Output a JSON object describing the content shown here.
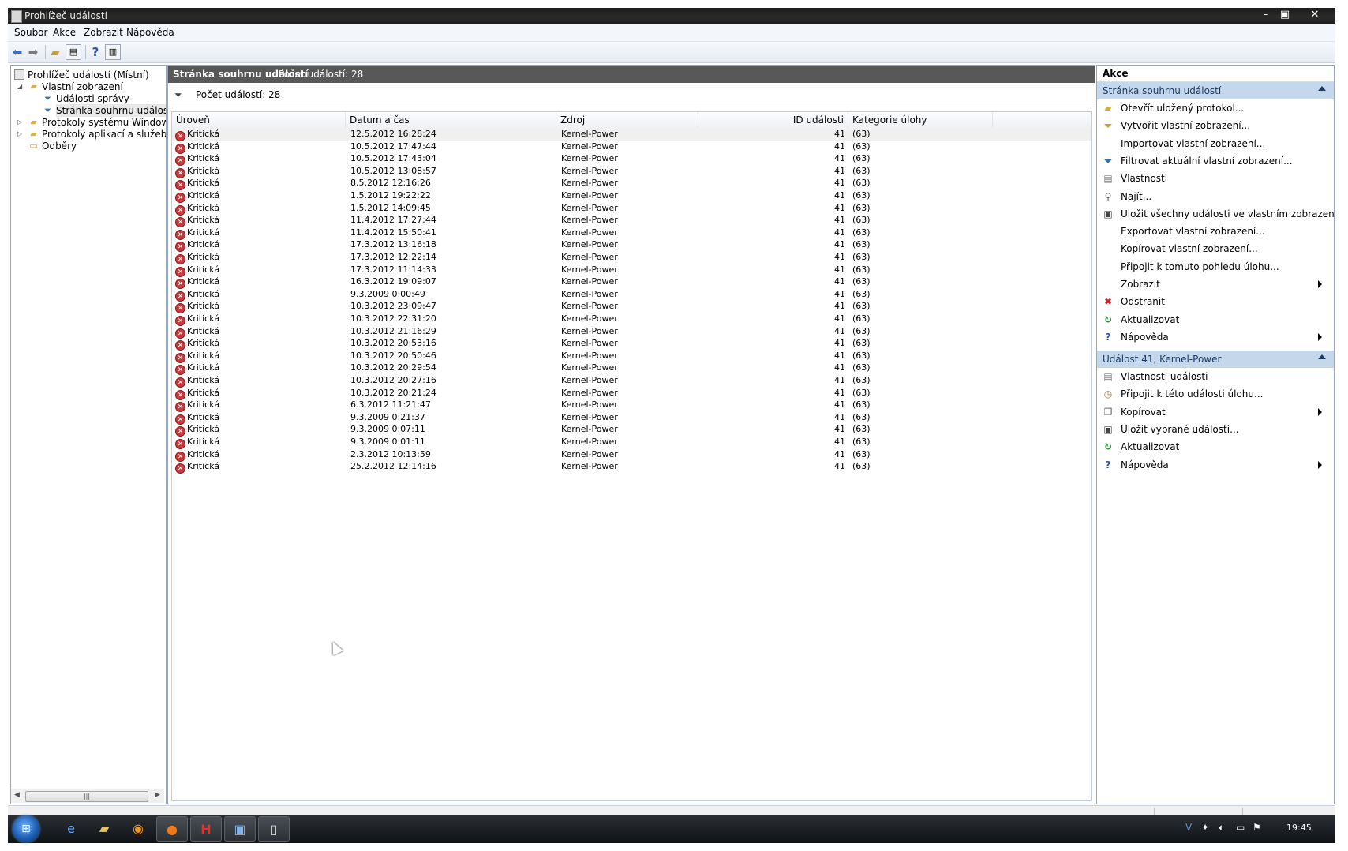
{
  "window": {
    "title": "Prohlížeč událostí",
    "controls": {
      "minimize": "–",
      "maximize": "▣",
      "close": "✕"
    }
  },
  "menu": [
    "Soubor",
    "Akce",
    "Zobrazit",
    "Nápověda"
  ],
  "toolbar": {
    "icons": [
      "back-arrow-icon",
      "forward-arrow-icon",
      "up-folder-icon",
      "show-hide-tree-icon",
      "help-icon",
      "show-hide-action-pane-icon"
    ]
  },
  "tree": [
    {
      "label": "Prohlížeč událostí (Místní)",
      "icon": "event-viewer-icon",
      "level": 0,
      "expander": ""
    },
    {
      "label": "Vlastní zobrazení",
      "icon": "folder-icon",
      "level": 1,
      "expander": "◢"
    },
    {
      "label": "Události správy",
      "icon": "filter-icon",
      "level": 2,
      "expander": ""
    },
    {
      "label": "Stránka souhrnu událostí",
      "icon": "filter-icon",
      "level": 2,
      "expander": "",
      "selected": true
    },
    {
      "label": "Protokoly systému Windows",
      "icon": "folder-icon",
      "level": 1,
      "expander": "▷"
    },
    {
      "label": "Protokoly aplikací a služeb",
      "icon": "folder-icon",
      "level": 1,
      "expander": "▷"
    },
    {
      "label": "Odběry",
      "icon": "subscriptions-icon",
      "level": 1,
      "expander": ""
    }
  ],
  "center": {
    "header_title": "Stránka souhrnu událostí",
    "header_count": "Počet událostí: 28",
    "filter_text": "Počet událostí: 28",
    "columns": [
      "Úroveň",
      "Datum a čas",
      "Zdroj",
      "ID události",
      "Kategorie úlohy"
    ],
    "rows": [
      {
        "level": "Kritická",
        "date": "12.5.2012 16:28:24",
        "source": "Kernel-Power",
        "id": "41",
        "cat": "(63)"
      },
      {
        "level": "Kritická",
        "date": "10.5.2012 17:47:44",
        "source": "Kernel-Power",
        "id": "41",
        "cat": "(63)"
      },
      {
        "level": "Kritická",
        "date": "10.5.2012 17:43:04",
        "source": "Kernel-Power",
        "id": "41",
        "cat": "(63)"
      },
      {
        "level": "Kritická",
        "date": "10.5.2012 13:08:57",
        "source": "Kernel-Power",
        "id": "41",
        "cat": "(63)"
      },
      {
        "level": "Kritická",
        "date": "8.5.2012 12:16:26",
        "source": "Kernel-Power",
        "id": "41",
        "cat": "(63)"
      },
      {
        "level": "Kritická",
        "date": "1.5.2012 19:22:22",
        "source": "Kernel-Power",
        "id": "41",
        "cat": "(63)"
      },
      {
        "level": "Kritická",
        "date": "1.5.2012 14:09:45",
        "source": "Kernel-Power",
        "id": "41",
        "cat": "(63)"
      },
      {
        "level": "Kritická",
        "date": "11.4.2012 17:27:44",
        "source": "Kernel-Power",
        "id": "41",
        "cat": "(63)"
      },
      {
        "level": "Kritická",
        "date": "11.4.2012 15:50:41",
        "source": "Kernel-Power",
        "id": "41",
        "cat": "(63)"
      },
      {
        "level": "Kritická",
        "date": "17.3.2012 13:16:18",
        "source": "Kernel-Power",
        "id": "41",
        "cat": "(63)"
      },
      {
        "level": "Kritická",
        "date": "17.3.2012 12:22:14",
        "source": "Kernel-Power",
        "id": "41",
        "cat": "(63)"
      },
      {
        "level": "Kritická",
        "date": "17.3.2012 11:14:33",
        "source": "Kernel-Power",
        "id": "41",
        "cat": "(63)"
      },
      {
        "level": "Kritická",
        "date": "16.3.2012 19:09:07",
        "source": "Kernel-Power",
        "id": "41",
        "cat": "(63)"
      },
      {
        "level": "Kritická",
        "date": "9.3.2009 0:00:49",
        "source": "Kernel-Power",
        "id": "41",
        "cat": "(63)"
      },
      {
        "level": "Kritická",
        "date": "10.3.2012 23:09:47",
        "source": "Kernel-Power",
        "id": "41",
        "cat": "(63)"
      },
      {
        "level": "Kritická",
        "date": "10.3.2012 22:31:20",
        "source": "Kernel-Power",
        "id": "41",
        "cat": "(63)"
      },
      {
        "level": "Kritická",
        "date": "10.3.2012 21:16:29",
        "source": "Kernel-Power",
        "id": "41",
        "cat": "(63)"
      },
      {
        "level": "Kritická",
        "date": "10.3.2012 20:53:16",
        "source": "Kernel-Power",
        "id": "41",
        "cat": "(63)"
      },
      {
        "level": "Kritická",
        "date": "10.3.2012 20:50:46",
        "source": "Kernel-Power",
        "id": "41",
        "cat": "(63)"
      },
      {
        "level": "Kritická",
        "date": "10.3.2012 20:29:54",
        "source": "Kernel-Power",
        "id": "41",
        "cat": "(63)"
      },
      {
        "level": "Kritická",
        "date": "10.3.2012 20:27:16",
        "source": "Kernel-Power",
        "id": "41",
        "cat": "(63)"
      },
      {
        "level": "Kritická",
        "date": "10.3.2012 20:21:24",
        "source": "Kernel-Power",
        "id": "41",
        "cat": "(63)"
      },
      {
        "level": "Kritická",
        "date": "6.3.2012 11:21:47",
        "source": "Kernel-Power",
        "id": "41",
        "cat": "(63)"
      },
      {
        "level": "Kritická",
        "date": "9.3.2009 0:21:37",
        "source": "Kernel-Power",
        "id": "41",
        "cat": "(63)"
      },
      {
        "level": "Kritická",
        "date": "9.3.2009 0:07:11",
        "source": "Kernel-Power",
        "id": "41",
        "cat": "(63)"
      },
      {
        "level": "Kritická",
        "date": "9.3.2009 0:01:11",
        "source": "Kernel-Power",
        "id": "41",
        "cat": "(63)"
      },
      {
        "level": "Kritická",
        "date": "2.3.2012 10:13:59",
        "source": "Kernel-Power",
        "id": "41",
        "cat": "(63)"
      },
      {
        "level": "Kritická",
        "date": "25.2.2012 12:14:16",
        "source": "Kernel-Power",
        "id": "41",
        "cat": "(63)"
      }
    ]
  },
  "actions": {
    "title": "Akce",
    "section1": {
      "title": "Stránka souhrnu událostí",
      "items": [
        {
          "label": "Otevřít uložený protokol...",
          "icon": "open-folder-icon",
          "submenu": false
        },
        {
          "label": "Vytvořit vlastní zobrazení...",
          "icon": "create-filter-icon",
          "submenu": false
        },
        {
          "label": "Importovat vlastní zobrazení...",
          "icon": "",
          "submenu": false
        },
        {
          "label": "Filtrovat aktuální vlastní zobrazení...",
          "icon": "filter-icon",
          "submenu": false
        },
        {
          "label": "Vlastnosti",
          "icon": "properties-icon",
          "submenu": false
        },
        {
          "label": "Najít...",
          "icon": "find-icon",
          "submenu": false
        },
        {
          "label": "Uložit všechny události ve vlastním zobrazení j...",
          "icon": "save-icon",
          "submenu": false
        },
        {
          "label": "Exportovat vlastní zobrazení...",
          "icon": "",
          "submenu": false
        },
        {
          "label": "Kopírovat vlastní zobrazení...",
          "icon": "",
          "submenu": false
        },
        {
          "label": "Připojit k tomuto pohledu úlohu...",
          "icon": "",
          "submenu": false
        },
        {
          "label": "Zobrazit",
          "icon": "",
          "submenu": true
        },
        {
          "label": "Odstranit",
          "icon": "delete-icon",
          "submenu": false
        },
        {
          "label": "Aktualizovat",
          "icon": "refresh-icon",
          "submenu": false
        },
        {
          "label": "Nápověda",
          "icon": "help-icon",
          "submenu": true
        }
      ]
    },
    "section2": {
      "title": "Událost 41, Kernel-Power",
      "items": [
        {
          "label": "Vlastnosti události",
          "icon": "properties-icon",
          "submenu": false
        },
        {
          "label": "Připojit k této události úlohu...",
          "icon": "attach-task-icon",
          "submenu": false
        },
        {
          "label": "Kopírovat",
          "icon": "copy-icon",
          "submenu": true
        },
        {
          "label": "Uložit vybrané události...",
          "icon": "save-icon",
          "submenu": false
        },
        {
          "label": "Aktualizovat",
          "icon": "refresh-icon",
          "submenu": false
        },
        {
          "label": "Nápověda",
          "icon": "help-icon",
          "submenu": true
        }
      ]
    }
  },
  "taskbar": {
    "apps": [
      "internet-explorer-icon",
      "explorer-folder-icon",
      "avast-icon",
      "firefox-icon",
      "h-app-icon",
      "remote-desktop-icon",
      "event-viewer-icon"
    ],
    "tray": [
      "shield-icon",
      "network-app-icon",
      "volume-icon",
      "network-icon",
      "flag-icon"
    ],
    "clock": "19:45"
  },
  "colors": {
    "critical": "#c8383b",
    "section_header": "#c5d7ea",
    "center_header": "#585858"
  }
}
